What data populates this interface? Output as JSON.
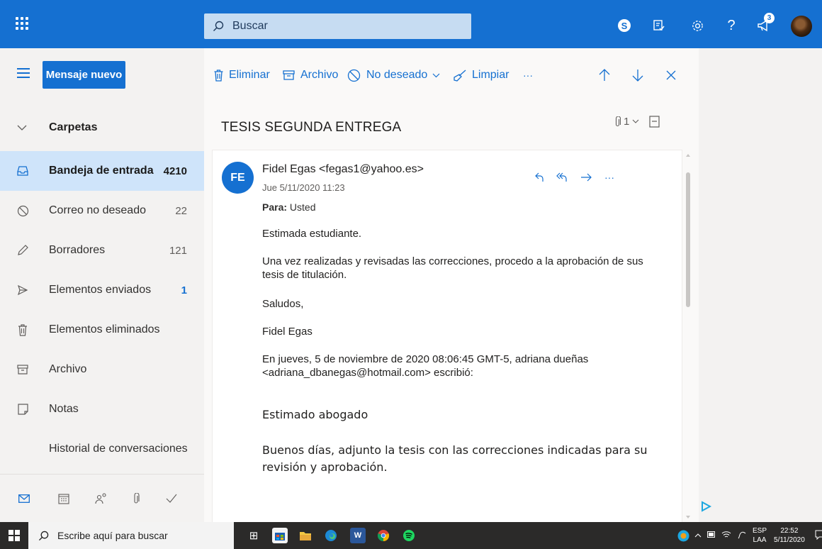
{
  "topbar": {
    "search_placeholder": "Buscar",
    "notification_count": "3",
    "skype_letter": "S"
  },
  "sidebar": {
    "new_message_label": "Mensaje nuevo",
    "folders_header": "Carpetas",
    "folders": [
      {
        "label": "Bandeja de entrada",
        "count": "4210",
        "icon": "inbox-icon",
        "active": true
      },
      {
        "label": "Correo no deseado",
        "count": "22",
        "icon": "junk-icon"
      },
      {
        "label": "Borradores",
        "count": "121",
        "icon": "pencil-icon"
      },
      {
        "label": "Elementos enviados",
        "count": "1",
        "icon": "send-icon"
      },
      {
        "label": "Elementos eliminados",
        "count": "",
        "icon": "trash-icon"
      },
      {
        "label": "Archivo",
        "count": "",
        "icon": "archive-icon"
      },
      {
        "label": "Notas",
        "count": "",
        "icon": "note-icon"
      },
      {
        "label": "Historial de conversaciones",
        "count": "",
        "icon": ""
      }
    ]
  },
  "commands": {
    "delete": "Eliminar",
    "archive": "Archivo",
    "junk": "No deseado",
    "sweep": "Limpiar",
    "more": "···"
  },
  "message": {
    "subject": "TESIS SEGUNDA ENTREGA",
    "attachment_count": "1",
    "avatar_initials": "FE",
    "sender": "Fidel Egas <fegas1@yahoo.es>",
    "date": "Jue 5/11/2020 11:23",
    "to_label": "Para:",
    "to_value": "Usted",
    "body": [
      "Estimada estudiante.",
      "Una vez realizadas y revisadas las correcciones, procedo a la aprobación de sus tesis de titulación.",
      "Saludos,",
      "Fidel Egas",
      "En jueves, 5 de noviembre de 2020 08:06:45 GMT-5, adriana dueñas <adriana_dbanegas@hotmail.com> escribió:"
    ],
    "quoted": [
      "Estimado abogado",
      "Buenos días, adjunto la tesis con las correcciones indicadas para su revisión y aprobación."
    ]
  },
  "taskbar": {
    "search_placeholder": "Escribe aquí para buscar",
    "lang_top": "ESP",
    "lang_bottom": "LAA",
    "time": "22:52",
    "date": "5/11/2020"
  },
  "colors": {
    "brand": "#1570d1",
    "active_folder": "#cfe4fa"
  }
}
